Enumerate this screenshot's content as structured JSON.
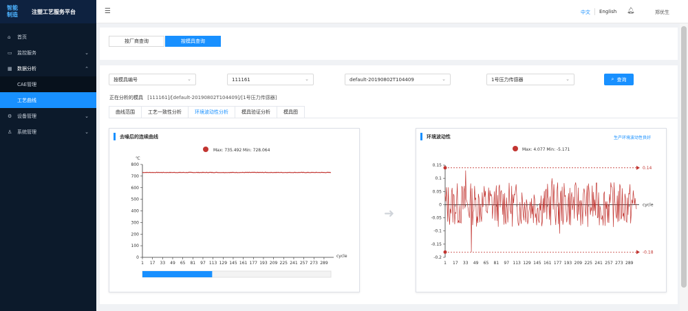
{
  "app": {
    "logo_text": "智能制造",
    "title": "注塑工艺服务平台"
  },
  "sidebar": {
    "items": [
      {
        "label": "首页",
        "icon": "home-icon"
      },
      {
        "label": "监控服务",
        "icon": "monitor-icon"
      },
      {
        "label": "数据分析",
        "icon": "grid-icon"
      },
      {
        "label": "设备管理",
        "icon": "gear-icon"
      },
      {
        "label": "系统管理",
        "icon": "user-icon"
      }
    ],
    "sub_items": [
      {
        "label": "CAE管理"
      },
      {
        "label": "工艺曲线"
      }
    ]
  },
  "header": {
    "lang_zh": "中文",
    "lang_en": "English",
    "user_name": "郑优生"
  },
  "mode_tabs": [
    {
      "label": "按厂商查询"
    },
    {
      "label": "按模具查询"
    }
  ],
  "filters": {
    "type_select": "按模具编号",
    "mold_select": "111161",
    "data_select": "default-20190802T104409",
    "sensor_select": "1号压力传感器",
    "query_label": "查询"
  },
  "analysis": {
    "prefix": "正在分析的模具",
    "path": "[111161]/[default-20190802T104409]/[1号压力传感器]"
  },
  "tabs": [
    {
      "label": "曲线范围"
    },
    {
      "label": "工艺一致性分析"
    },
    {
      "label": "环境波动性分析"
    },
    {
      "label": "模具验证分析"
    },
    {
      "label": "模具图"
    }
  ],
  "left_panel": {
    "title": "去噪后的连续曲线"
  },
  "right_panel": {
    "title": "环境波动性",
    "link": "生产环境波动性良好"
  },
  "chart_data": [
    {
      "type": "line",
      "title": "",
      "legend_text": "Max: 735.492 Min: 728.064",
      "ylabel": "℃",
      "xlabel": "cycle",
      "ylim": [
        0,
        800
      ],
      "yticks": [
        0,
        100,
        200,
        300,
        400,
        500,
        600,
        700,
        800
      ],
      "xticks": [
        1,
        17,
        33,
        49,
        65,
        81,
        97,
        113,
        129,
        145,
        161,
        177,
        193,
        209,
        225,
        241,
        257,
        273,
        289
      ],
      "x_range": [
        1,
        300
      ],
      "series": [
        {
          "values_approx": 731,
          "max": 735.492,
          "min": 728.064
        }
      ],
      "color": "#c23531",
      "scrollbar_fraction": 0.37
    },
    {
      "type": "line",
      "title": "",
      "legend_text": "Max: 4.077 Min: -5.171",
      "xlabel": "cycle",
      "ylim": [
        -0.2,
        0.15
      ],
      "yticks": [
        0.15,
        0.1,
        0.05,
        0,
        -0.05,
        -0.1,
        -0.15,
        -0.2
      ],
      "xticks": [
        1,
        17,
        33,
        49,
        65,
        81,
        97,
        113,
        129,
        145,
        161,
        177,
        193,
        209,
        225,
        241,
        257,
        273,
        289
      ],
      "x_range": [
        1,
        300
      ],
      "upper_limit": 0.14,
      "lower_limit": -0.18,
      "upper_label": "0.14",
      "lower_label": "-0.18",
      "color": "#c23531"
    }
  ]
}
